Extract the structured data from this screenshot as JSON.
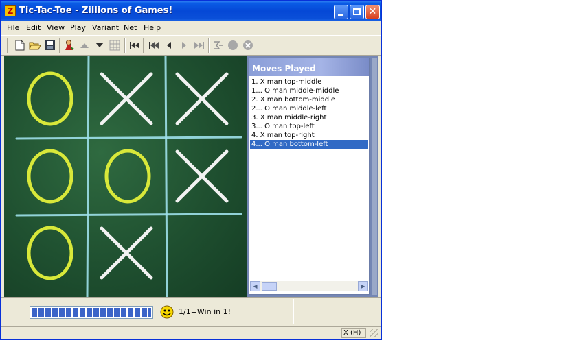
{
  "window": {
    "title": "Tic-Tac-Toe - Zillions of Games!",
    "app_icon_glyph": "Z"
  },
  "menu": [
    "File",
    "Edit",
    "View",
    "Play",
    "Variant",
    "Net",
    "Help"
  ],
  "toolbar": {
    "buttons": [
      "new-icon",
      "open-icon",
      "save-icon",
      "player-icon",
      "up-arrow-icon",
      "down-arrow-icon",
      "board-grid-icon",
      "rewind-icon",
      "step-back-icon",
      "back-icon",
      "forward-icon",
      "fast-forward-icon",
      "engine-icon",
      "circle-icon",
      "cancel-icon"
    ]
  },
  "board": {
    "cells": [
      [
        "O",
        "X",
        "X"
      ],
      [
        "O",
        "O",
        "X"
      ],
      [
        "O",
        "X",
        ""
      ]
    ],
    "colors": {
      "o": "#d8e83a",
      "x": "#f2f2f2",
      "grid": "#9ee0ea"
    }
  },
  "moves_panel": {
    "title": "Moves Played",
    "moves": [
      "1. X man top-middle",
      "1... O man middle-middle",
      "2. X man bottom-middle",
      "2... O man middle-left",
      "3. X man middle-right",
      "3... O man top-left",
      "4. X man top-right",
      "4... O man bottom-left"
    ],
    "selected_index": 7
  },
  "status": {
    "progress_fraction": 1.0,
    "result_text": "1/1=Win in 1!",
    "mode": "X (H)"
  }
}
